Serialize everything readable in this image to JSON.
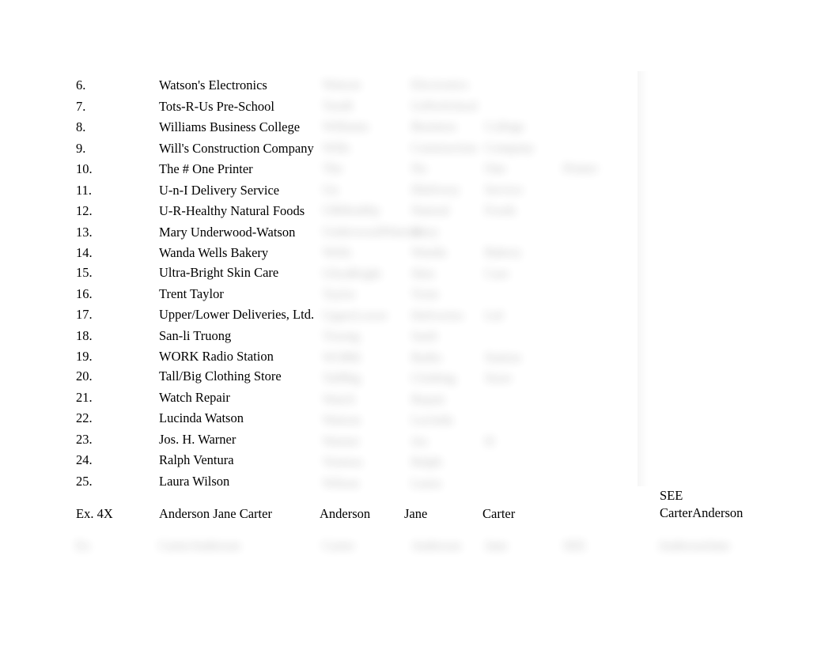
{
  "document": {
    "title": "Alphabetic Indexing Exercise — Business Names",
    "background_color": "#ffffff",
    "text_color": "#000000"
  },
  "exercise_list": {
    "name": "numbered-business-name-list",
    "start_number": 6,
    "rows": [
      {
        "number": "6.",
        "name": "Watson's Electronics"
      },
      {
        "number": "7.",
        "name": "Tots-R-Us Pre-School"
      },
      {
        "number": "8.",
        "name": "Williams Business College"
      },
      {
        "number": "9.",
        "name": "Will's Construction Company"
      },
      {
        "number": "10.",
        "name": "The # One Printer"
      },
      {
        "number": "11.",
        "name": "U-n-I Delivery Service"
      },
      {
        "number": "12.",
        "name": "U-R-Healthy Natural Foods"
      },
      {
        "number": "13.",
        "name": "Mary Underwood-Watson"
      },
      {
        "number": "14.",
        "name": "Wanda Wells Bakery"
      },
      {
        "number": "15.",
        "name": "Ultra-Bright Skin Care"
      },
      {
        "number": "16.",
        "name": "Trent Taylor"
      },
      {
        "number": "17.",
        "name": "Upper/Lower Deliveries, Ltd."
      },
      {
        "number": "18.",
        "name": "San-li Truong"
      },
      {
        "number": "19.",
        "name": "WORK Radio Station"
      },
      {
        "number": "20.",
        "name": "Tall/Big Clothing Store"
      },
      {
        "number": "21.",
        "name": "Watch Repair"
      },
      {
        "number": "22.",
        "name": "Lucinda Watson"
      },
      {
        "number": "23.",
        "name": "Jos. H. Warner"
      },
      {
        "number": "24.",
        "name": "Ralph Ventura"
      },
      {
        "number": "25.",
        "name": "Laura Wilson"
      }
    ]
  },
  "example_row": {
    "label": "Ex. 4X",
    "source_name": "Anderson Jane Carter",
    "unit_1": "Anderson",
    "unit_2": "Jane",
    "unit_3": "Carter",
    "unit_4": "",
    "note_line_1": "SEE",
    "note_line_2": "CarterAnderson"
  },
  "answer_key": {
    "name": "blurred-answer-key-table",
    "visible": false,
    "description": "Obscured answer-key columns to the right of the exercise list",
    "column_count": 5,
    "rows": [
      {
        "c1": "Watson",
        "c2": "Electronics",
        "c3": "",
        "c4": "",
        "c5": ""
      },
      {
        "c1": "TotsR",
        "c2": "UsPreSchool",
        "c3": "",
        "c4": "",
        "c5": ""
      },
      {
        "c1": "Williams",
        "c2": "Business",
        "c3": "College",
        "c4": "",
        "c5": ""
      },
      {
        "c1": "Wills",
        "c2": "Construction",
        "c3": "Company",
        "c4": "",
        "c5": ""
      },
      {
        "c1": "The",
        "c2": "No",
        "c3": "One",
        "c4": "Printer",
        "c5": ""
      },
      {
        "c1": "Un",
        "c2": "IDelivery",
        "c3": "Service",
        "c4": "",
        "c5": ""
      },
      {
        "c1": "URHealthy",
        "c2": "Natural",
        "c3": "Foods",
        "c4": "",
        "c5": ""
      },
      {
        "c1": "UnderwoodWatson",
        "c2": "Mary",
        "c3": "",
        "c4": "",
        "c5": ""
      },
      {
        "c1": "Wells",
        "c2": "Wanda",
        "c3": "Bakery",
        "c4": "",
        "c5": ""
      },
      {
        "c1": "UltraBright",
        "c2": "Skin",
        "c3": "Care",
        "c4": "",
        "c5": ""
      },
      {
        "c1": "Taylor",
        "c2": "Trent",
        "c3": "",
        "c4": "",
        "c5": ""
      },
      {
        "c1": "UpperLower",
        "c2": "Deliveries",
        "c3": "Ltd",
        "c4": "",
        "c5": ""
      },
      {
        "c1": "Truong",
        "c2": "Sanli",
        "c3": "",
        "c4": "",
        "c5": ""
      },
      {
        "c1": "WORK",
        "c2": "Radio",
        "c3": "Station",
        "c4": "",
        "c5": ""
      },
      {
        "c1": "TallBig",
        "c2": "Clothing",
        "c3": "Store",
        "c4": "",
        "c5": ""
      },
      {
        "c1": "Watch",
        "c2": "Repair",
        "c3": "",
        "c4": "",
        "c5": ""
      },
      {
        "c1": "Watson",
        "c2": "Lucinda",
        "c3": "",
        "c4": "",
        "c5": ""
      },
      {
        "c1": "Warner",
        "c2": "Jos",
        "c3": "H",
        "c4": "",
        "c5": ""
      },
      {
        "c1": "Ventura",
        "c2": "Ralph",
        "c3": "",
        "c4": "",
        "c5": ""
      },
      {
        "c1": "Wilson",
        "c2": "Laura",
        "c3": "",
        "c4": "",
        "c5": ""
      }
    ],
    "bottom_row": {
      "c1": "Ex",
      "c2": "CarterAnderson",
      "c3": "Carter",
      "c4": "Anderson",
      "c5": "Jane",
      "c6": "SEE",
      "c7": "AndersonJane"
    }
  }
}
